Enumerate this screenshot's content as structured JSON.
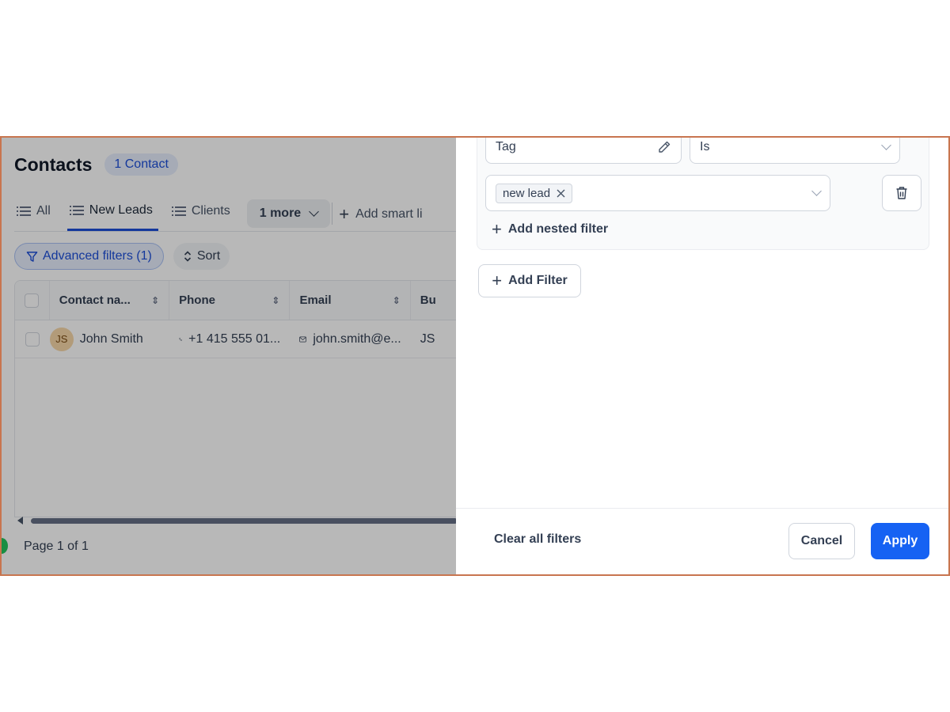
{
  "header": {
    "title": "Contacts",
    "count_badge": "1 Contact"
  },
  "tabs": [
    {
      "label": "All",
      "icon": "list-icon",
      "active": false
    },
    {
      "label": "New Leads",
      "icon": "list-icon",
      "active": true
    },
    {
      "label": "Clients",
      "icon": "list-icon",
      "active": false
    }
  ],
  "tabs_more": "1 more",
  "tabs_add": "Add smart li",
  "toolbar": {
    "advanced_filters": "Advanced filters (1)",
    "sort": "Sort"
  },
  "table": {
    "columns": [
      "Contact na...",
      "Phone",
      "Email",
      "Bu"
    ],
    "rows": [
      {
        "initials": "JS",
        "name": "John Smith",
        "phone": "+1 415 555 01...",
        "email": "john.smith@e...",
        "business": "JS"
      }
    ]
  },
  "pager": "Page 1 of 1",
  "filter_panel": {
    "field": "Tag",
    "operator": "Is",
    "value_chip": "new lead",
    "add_nested": "Add nested filter",
    "add_filter": "Add Filter",
    "clear_all": "Clear all filters",
    "cancel": "Cancel",
    "apply": "Apply"
  },
  "colors": {
    "accent": "#1d4ed8",
    "apply": "#1662f3",
    "frame_border": "#c8754f"
  }
}
